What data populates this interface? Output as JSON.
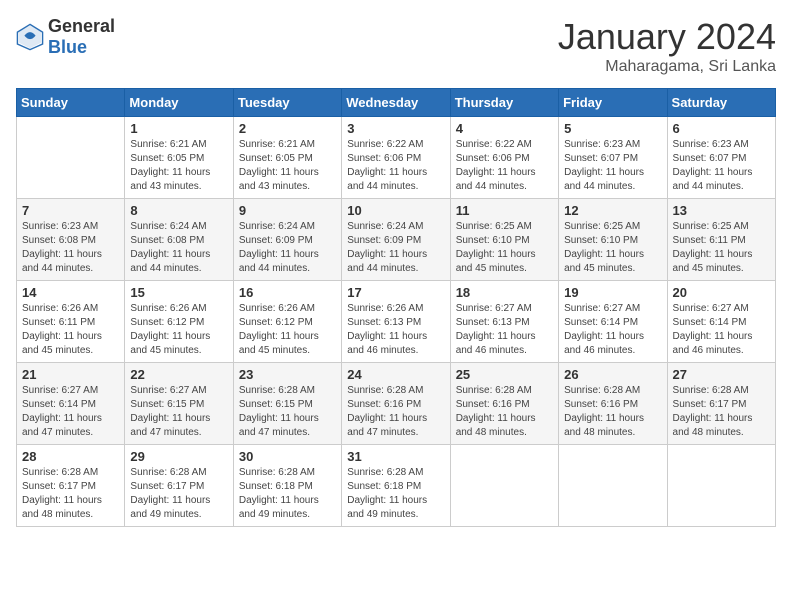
{
  "header": {
    "logo_general": "General",
    "logo_blue": "Blue",
    "title": "January 2024",
    "subtitle": "Maharagama, Sri Lanka"
  },
  "weekdays": [
    "Sunday",
    "Monday",
    "Tuesday",
    "Wednesday",
    "Thursday",
    "Friday",
    "Saturday"
  ],
  "weeks": [
    [
      {
        "day": "",
        "sunrise": "",
        "sunset": "",
        "daylight": ""
      },
      {
        "day": "1",
        "sunrise": "Sunrise: 6:21 AM",
        "sunset": "Sunset: 6:05 PM",
        "daylight": "Daylight: 11 hours and 43 minutes."
      },
      {
        "day": "2",
        "sunrise": "Sunrise: 6:21 AM",
        "sunset": "Sunset: 6:05 PM",
        "daylight": "Daylight: 11 hours and 43 minutes."
      },
      {
        "day": "3",
        "sunrise": "Sunrise: 6:22 AM",
        "sunset": "Sunset: 6:06 PM",
        "daylight": "Daylight: 11 hours and 44 minutes."
      },
      {
        "day": "4",
        "sunrise": "Sunrise: 6:22 AM",
        "sunset": "Sunset: 6:06 PM",
        "daylight": "Daylight: 11 hours and 44 minutes."
      },
      {
        "day": "5",
        "sunrise": "Sunrise: 6:23 AM",
        "sunset": "Sunset: 6:07 PM",
        "daylight": "Daylight: 11 hours and 44 minutes."
      },
      {
        "day": "6",
        "sunrise": "Sunrise: 6:23 AM",
        "sunset": "Sunset: 6:07 PM",
        "daylight": "Daylight: 11 hours and 44 minutes."
      }
    ],
    [
      {
        "day": "7",
        "sunrise": "Sunrise: 6:23 AM",
        "sunset": "Sunset: 6:08 PM",
        "daylight": "Daylight: 11 hours and 44 minutes."
      },
      {
        "day": "8",
        "sunrise": "Sunrise: 6:24 AM",
        "sunset": "Sunset: 6:08 PM",
        "daylight": "Daylight: 11 hours and 44 minutes."
      },
      {
        "day": "9",
        "sunrise": "Sunrise: 6:24 AM",
        "sunset": "Sunset: 6:09 PM",
        "daylight": "Daylight: 11 hours and 44 minutes."
      },
      {
        "day": "10",
        "sunrise": "Sunrise: 6:24 AM",
        "sunset": "Sunset: 6:09 PM",
        "daylight": "Daylight: 11 hours and 44 minutes."
      },
      {
        "day": "11",
        "sunrise": "Sunrise: 6:25 AM",
        "sunset": "Sunset: 6:10 PM",
        "daylight": "Daylight: 11 hours and 45 minutes."
      },
      {
        "day": "12",
        "sunrise": "Sunrise: 6:25 AM",
        "sunset": "Sunset: 6:10 PM",
        "daylight": "Daylight: 11 hours and 45 minutes."
      },
      {
        "day": "13",
        "sunrise": "Sunrise: 6:25 AM",
        "sunset": "Sunset: 6:11 PM",
        "daylight": "Daylight: 11 hours and 45 minutes."
      }
    ],
    [
      {
        "day": "14",
        "sunrise": "Sunrise: 6:26 AM",
        "sunset": "Sunset: 6:11 PM",
        "daylight": "Daylight: 11 hours and 45 minutes."
      },
      {
        "day": "15",
        "sunrise": "Sunrise: 6:26 AM",
        "sunset": "Sunset: 6:12 PM",
        "daylight": "Daylight: 11 hours and 45 minutes."
      },
      {
        "day": "16",
        "sunrise": "Sunrise: 6:26 AM",
        "sunset": "Sunset: 6:12 PM",
        "daylight": "Daylight: 11 hours and 45 minutes."
      },
      {
        "day": "17",
        "sunrise": "Sunrise: 6:26 AM",
        "sunset": "Sunset: 6:13 PM",
        "daylight": "Daylight: 11 hours and 46 minutes."
      },
      {
        "day": "18",
        "sunrise": "Sunrise: 6:27 AM",
        "sunset": "Sunset: 6:13 PM",
        "daylight": "Daylight: 11 hours and 46 minutes."
      },
      {
        "day": "19",
        "sunrise": "Sunrise: 6:27 AM",
        "sunset": "Sunset: 6:14 PM",
        "daylight": "Daylight: 11 hours and 46 minutes."
      },
      {
        "day": "20",
        "sunrise": "Sunrise: 6:27 AM",
        "sunset": "Sunset: 6:14 PM",
        "daylight": "Daylight: 11 hours and 46 minutes."
      }
    ],
    [
      {
        "day": "21",
        "sunrise": "Sunrise: 6:27 AM",
        "sunset": "Sunset: 6:14 PM",
        "daylight": "Daylight: 11 hours and 47 minutes."
      },
      {
        "day": "22",
        "sunrise": "Sunrise: 6:27 AM",
        "sunset": "Sunset: 6:15 PM",
        "daylight": "Daylight: 11 hours and 47 minutes."
      },
      {
        "day": "23",
        "sunrise": "Sunrise: 6:28 AM",
        "sunset": "Sunset: 6:15 PM",
        "daylight": "Daylight: 11 hours and 47 minutes."
      },
      {
        "day": "24",
        "sunrise": "Sunrise: 6:28 AM",
        "sunset": "Sunset: 6:16 PM",
        "daylight": "Daylight: 11 hours and 47 minutes."
      },
      {
        "day": "25",
        "sunrise": "Sunrise: 6:28 AM",
        "sunset": "Sunset: 6:16 PM",
        "daylight": "Daylight: 11 hours and 48 minutes."
      },
      {
        "day": "26",
        "sunrise": "Sunrise: 6:28 AM",
        "sunset": "Sunset: 6:16 PM",
        "daylight": "Daylight: 11 hours and 48 minutes."
      },
      {
        "day": "27",
        "sunrise": "Sunrise: 6:28 AM",
        "sunset": "Sunset: 6:17 PM",
        "daylight": "Daylight: 11 hours and 48 minutes."
      }
    ],
    [
      {
        "day": "28",
        "sunrise": "Sunrise: 6:28 AM",
        "sunset": "Sunset: 6:17 PM",
        "daylight": "Daylight: 11 hours and 48 minutes."
      },
      {
        "day": "29",
        "sunrise": "Sunrise: 6:28 AM",
        "sunset": "Sunset: 6:17 PM",
        "daylight": "Daylight: 11 hours and 49 minutes."
      },
      {
        "day": "30",
        "sunrise": "Sunrise: 6:28 AM",
        "sunset": "Sunset: 6:18 PM",
        "daylight": "Daylight: 11 hours and 49 minutes."
      },
      {
        "day": "31",
        "sunrise": "Sunrise: 6:28 AM",
        "sunset": "Sunset: 6:18 PM",
        "daylight": "Daylight: 11 hours and 49 minutes."
      },
      {
        "day": "",
        "sunrise": "",
        "sunset": "",
        "daylight": ""
      },
      {
        "day": "",
        "sunrise": "",
        "sunset": "",
        "daylight": ""
      },
      {
        "day": "",
        "sunrise": "",
        "sunset": "",
        "daylight": ""
      }
    ]
  ]
}
